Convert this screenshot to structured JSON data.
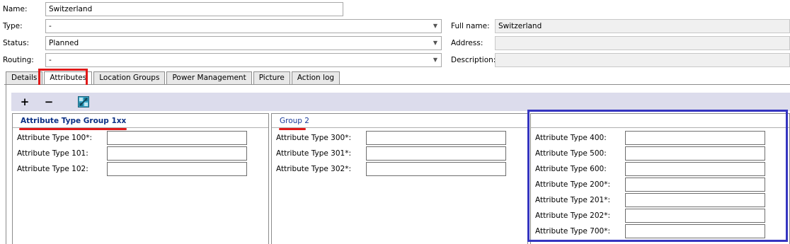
{
  "form": {
    "name_label": "Name:",
    "name_value": "Switzerland",
    "type_label": "Type:",
    "type_value": "-",
    "status_label": "Status:",
    "status_value": "Planned",
    "routing_label": "Routing:",
    "routing_value": "-",
    "fullname_label": "Full name:",
    "fullname_value": "Switzerland",
    "address_label": "Address:",
    "address_value": "",
    "description_label": "Description:",
    "description_value": ""
  },
  "tabs": [
    {
      "label": "Details"
    },
    {
      "label": "Attributes",
      "active": true
    },
    {
      "label": "Location Groups"
    },
    {
      "label": "Power Management"
    },
    {
      "label": "Picture"
    },
    {
      "label": "Action log"
    }
  ],
  "toolbar": {
    "add_label": "+",
    "remove_label": "−",
    "icon": "grid-settings-icon"
  },
  "panels": {
    "group1": {
      "title": "Attribute Type Group 1xx",
      "rows": [
        "Attribute Type 100*:",
        "Attribute Type 101:",
        "Attribute Type 102:"
      ]
    },
    "group2": {
      "title": "Group 2",
      "rows": [
        "Attribute Type 300*:",
        "Attribute Type 301*:",
        "Attribute Type 302*:"
      ]
    },
    "group3": {
      "title": "",
      "rows": [
        "Attribute Type 400:",
        "Attribute Type 500:",
        "Attribute Type 600:",
        "Attribute Type 200*:",
        "Attribute Type 201*:",
        "Attribute Type 202*:",
        "Attribute Type 700*:"
      ]
    }
  },
  "colors": {
    "annotation_red": "#e01919",
    "annotation_blue": "#3535c0",
    "toolbar_bg": "#dcdcec",
    "group_title": "#0a2f84"
  }
}
